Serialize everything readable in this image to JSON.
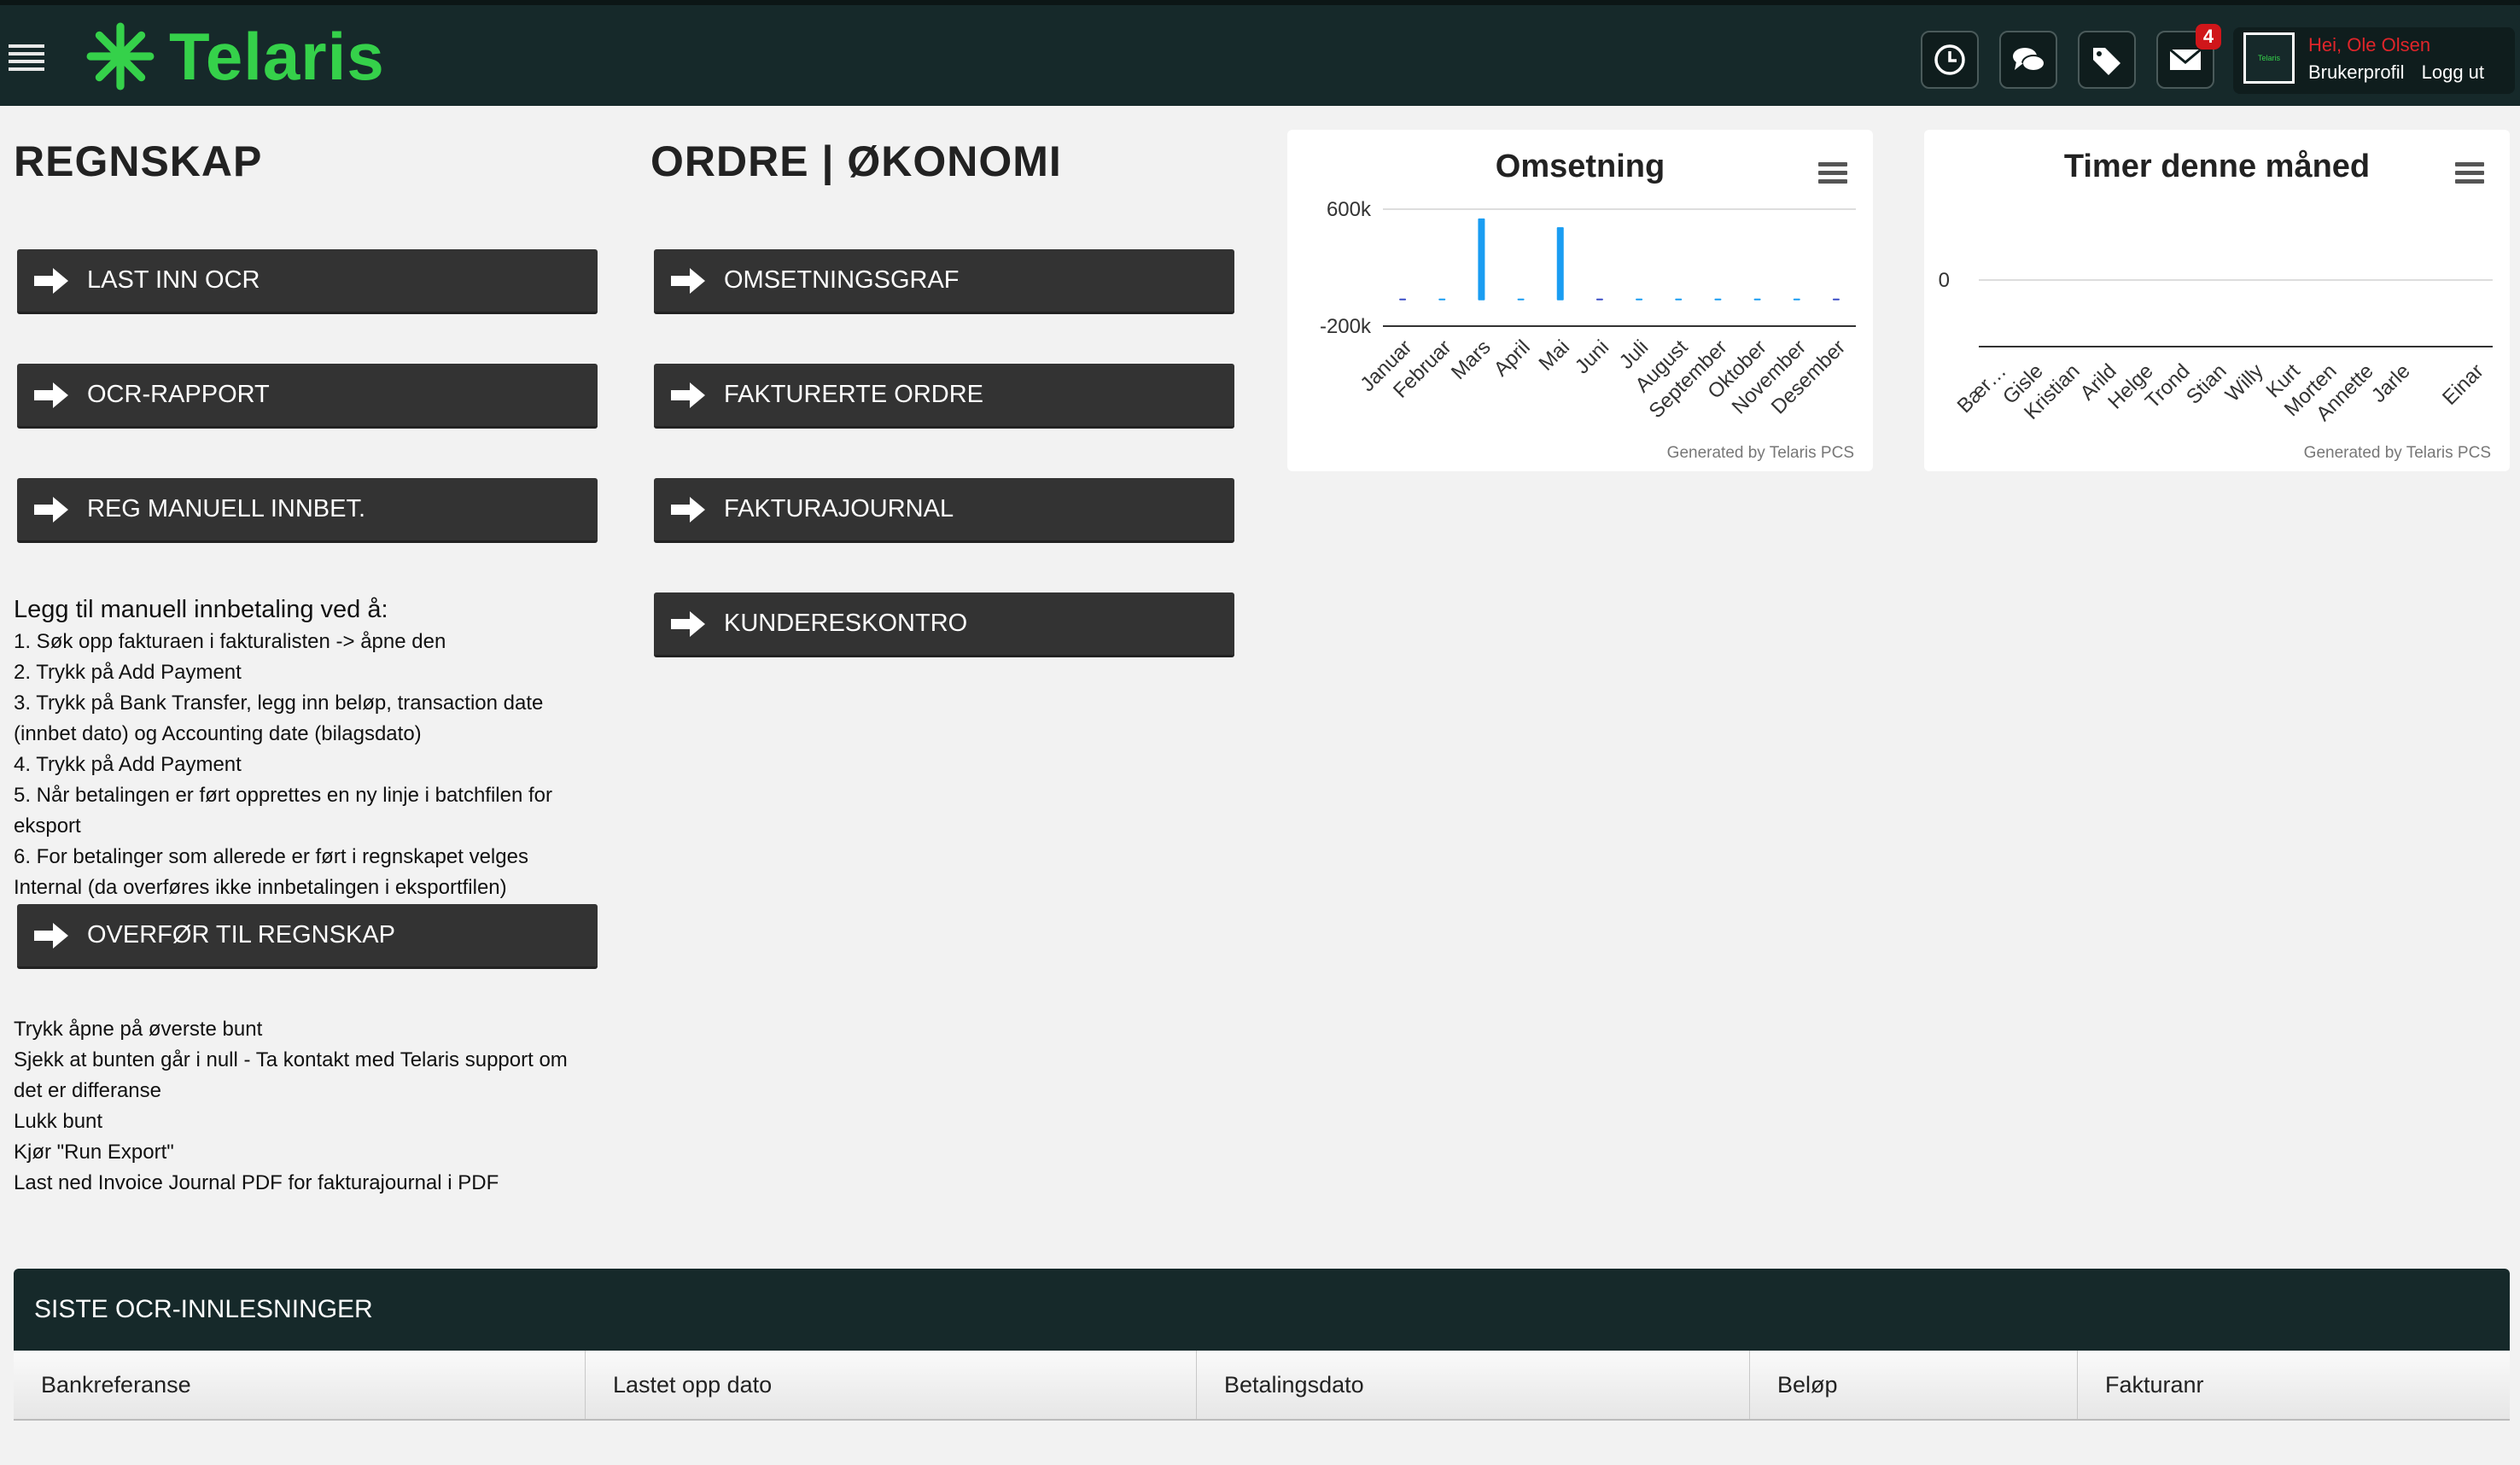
{
  "app": {
    "brand": "Telaris",
    "mini_logo_text": "Telaris",
    "icons": [
      "menu-icon",
      "clock-icon",
      "chat-icon",
      "tags-icon",
      "mail-icon"
    ],
    "mail_badge": "4",
    "user_greeting": "Hei, Ole Olsen",
    "profile_link": "Brukerprofil",
    "logout_link": "Logg ut",
    "colors": {
      "topbar": "#16292a",
      "brand": "#35d14a",
      "button": "#333333",
      "badge": "#d0161a",
      "bar": "#1a9df2"
    }
  },
  "regnskap": {
    "title": "REGNSKAP",
    "buttons": [
      "LAST INN OCR",
      "OCR-RAPPORT",
      "REG MANUELL INNBET."
    ],
    "instructions_title": "Legg til manuell innbetaling ved å:",
    "instructions": [
      "1. Søk opp fakturaen i fakturalisten -> åpne den",
      "2. Trykk på Add Payment",
      "3. Trykk på Bank Transfer, legg inn beløp, transaction date (innbet dato) og Accounting date (bilagsdato)",
      "4. Trykk på Add Payment",
      "5. Når betalingen er ført opprettes en ny linje i batchfilen for eksport",
      "6. For betalinger som allerede er ført i regnskapet velges Internal (da overføres ikke innbetalingen i eksportfilen)"
    ],
    "transfer_button": "OVERFØR TIL REGNSKAP",
    "notes": [
      "Trykk åpne på øverste bunt",
      "Sjekk at bunten går i null - Ta kontakt med Telaris support om det er differanse",
      "Lukk bunt",
      "Kjør \"Run Export\"",
      "Last ned Invoice Journal PDF for fakturajournal i PDF"
    ]
  },
  "ordre": {
    "title": "ORDRE | ØKONOMI",
    "buttons": [
      "OMSETNINGSGRAF",
      "FAKTURERTE ORDRE",
      "FAKTURAJOURNAL",
      "KUNDERESKONTRO"
    ]
  },
  "charts": {
    "credit": "Generated by Telaris PCS"
  },
  "chart_data": [
    {
      "type": "bar",
      "title": "Omsetning",
      "categories": [
        "Januar",
        "Februar",
        "Mars",
        "April",
        "Mai",
        "Juni",
        "Juli",
        "August",
        "September",
        "Oktober",
        "November",
        "Desember"
      ],
      "values": [
        5000,
        0,
        560000,
        0,
        500000,
        5000,
        0,
        0,
        0,
        0,
        0,
        10000
      ],
      "ytick_labels": [
        "600k",
        "-200k"
      ],
      "ylim": [
        -200000,
        600000
      ],
      "xlabel": "",
      "ylabel": "",
      "grid": true
    },
    {
      "type": "bar",
      "title": "Timer denne måned",
      "categories": [
        "Bær…",
        "Gisle",
        "Kristian",
        "Arild",
        "Helge",
        "Trond",
        "Stian",
        "Willy",
        "Kurt",
        "Morten",
        "Annette",
        "Jarle",
        "",
        "Einar"
      ],
      "values": [
        0,
        0,
        0,
        0,
        0,
        0,
        0,
        0,
        0,
        0,
        0,
        0,
        0,
        0
      ],
      "ytick_labels": [
        "0"
      ],
      "xlabel": "",
      "ylabel": "",
      "grid": true
    }
  ],
  "ocr_table": {
    "title": "SISTE OCR-INNLESNINGER",
    "columns": [
      "Bankreferanse",
      "Lastet opp dato",
      "Betalingsdato",
      "Beløp",
      "Fakturanr"
    ]
  }
}
